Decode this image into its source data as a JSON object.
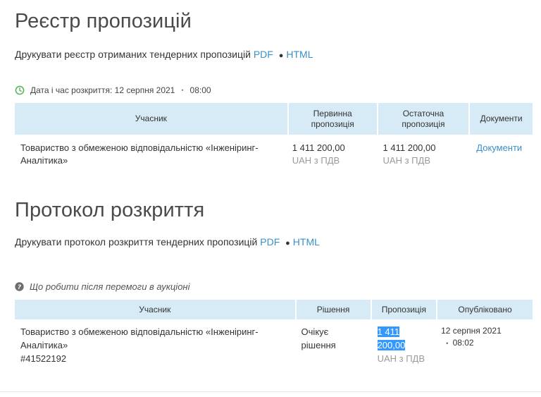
{
  "registry": {
    "title": "Реєстр пропозицій",
    "print_text": "Друкувати реєстр отриманих тендерних пропозицій",
    "pdf": "PDF",
    "html": "HTML",
    "dot": "●",
    "date_label": "Дата і час розкриття: 12 серпня 2021",
    "time": "08:00",
    "time_sep": "•",
    "columns": {
      "participant": "Учасник",
      "initial_1": "Первинна",
      "initial_2": "пропозиція",
      "final_1": "Остаточна",
      "final_2": "пропозиція",
      "documents": "Документи"
    },
    "row": {
      "participant_1": "Товариство з обмеженою відповідальністю «Інженіринг-",
      "participant_2": "Аналітика»",
      "initial": "1 411 200,00",
      "initial_sub": "UAH з ПДВ",
      "final": "1 411 200,00",
      "final_sub": "UAH з ПДВ",
      "documents": "Документи"
    }
  },
  "protocol": {
    "title": "Протокол розкриття",
    "print_text": "Друкувати протокол розкриття тендерних пропозицій",
    "pdf": "PDF",
    "html": "HTML",
    "dot": "●",
    "help": "Що робити після перемоги в аукціоні",
    "columns": {
      "participant": "Учасник",
      "decision": "Рішення",
      "offer": "Пропозиція",
      "published": "Опубліковано"
    },
    "row": {
      "participant_1": "Товариство з обмеженою відповідальністю «Інженіринг-",
      "participant_2": "Аналітика»",
      "participant_id": "#41522192",
      "decision_1": "Очікує",
      "decision_2": "рішення",
      "offer_1": "1 411",
      "offer_2": "200,00",
      "offer_sub": "UAH з ПДВ",
      "pub_date": "12 серпня 2021",
      "pub_sep": "•",
      "pub_time": "08:02"
    }
  },
  "colors": {
    "link": "#3a8fc8",
    "header_bg": "#d6ebf5",
    "clock_icon": "#5cb85c",
    "selection": "#3399ff"
  }
}
